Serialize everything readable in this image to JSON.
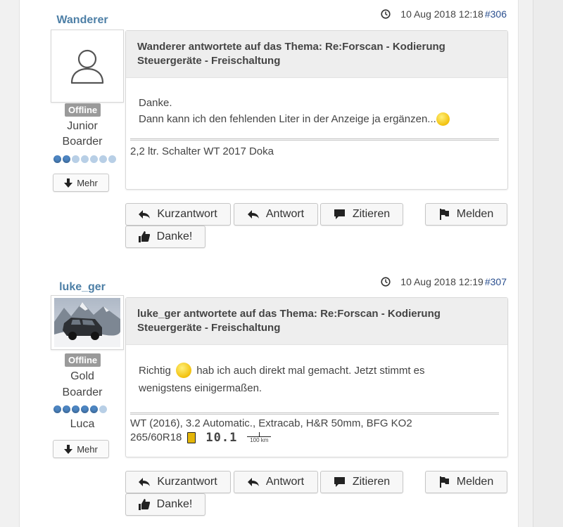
{
  "posts": [
    {
      "username": "Wanderer",
      "status": "Offline",
      "rank_line1": "Junior",
      "rank_line2": "Boarder",
      "rank_dots_filled": 2,
      "rank_dots_total": 7,
      "author_name": "",
      "more_label": "Mehr",
      "date": "10 Aug 2018 12:18",
      "post_number": "#306",
      "title_line1": "Wanderer antwortete auf das Thema: Re:Forscan - Kodierung",
      "title_line2": "Steuergeräte - Freischaltung",
      "body_line1": "Danke.",
      "body_line2": "Dann kann ich den fehlenden Liter in der Anzeige ja ergänzen...",
      "signature_line1": "2,2 ltr. Schalter WT 2017 Doka",
      "signature_line2": ""
    },
    {
      "username": "luke_ger",
      "status": "Offline",
      "rank_line1": "Gold",
      "rank_line2": "Boarder",
      "rank_dots_filled": 5,
      "rank_dots_total": 6,
      "author_name": "Luca",
      "more_label": "Mehr",
      "date": "10 Aug 2018 12:19",
      "post_number": "#307",
      "title_line1": "luke_ger antwortete auf das Thema: Re:Forscan - Kodierung",
      "title_line2": "Steuergeräte - Freischaltung",
      "body_part1": "Richtig",
      "body_part2": "hab ich auch direkt mal gemacht. Jetzt stimmt es",
      "body_line2": "wenigstens einigermaßen.",
      "signature_line1": "WT (2016), 3.2 Automatic., Extracab, H&R 50mm, BFG KO2",
      "signature_line2": "265/60R18",
      "consumption_value": "10.1",
      "consumption_unit": "100 km"
    }
  ],
  "actions": {
    "quick_reply": "Kurzantwort",
    "reply": "Antwort",
    "quote": "Zitieren",
    "report": "Melden",
    "thanks": "Danke!"
  },
  "colors": {
    "username": "#4d7fa6",
    "post_number": "#2a4f8f",
    "offline_badge": "#9a9a9a",
    "rank_dot": "#4d86c3"
  }
}
